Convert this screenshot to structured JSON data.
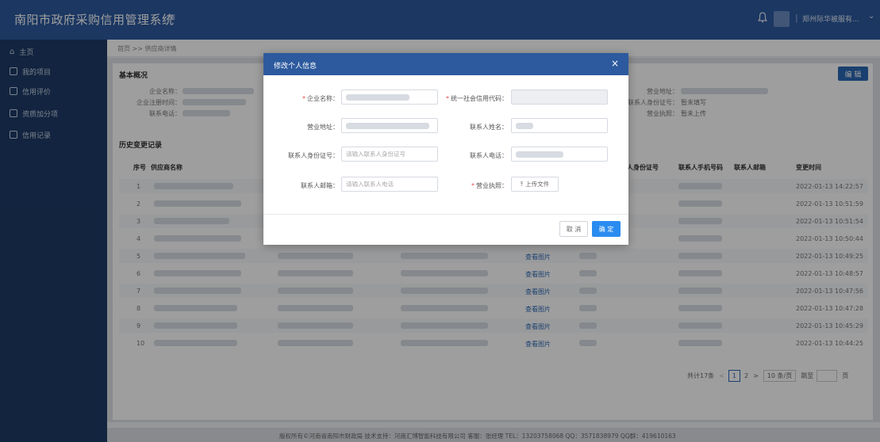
{
  "header": {
    "app_title": "南阳市政府采购信用管理系统",
    "menu_toggle": "≡",
    "user_name": "郑州际华被服有...",
    "separator": "|"
  },
  "sidebar": {
    "items": [
      {
        "label": "主页"
      },
      {
        "label": "我的项目"
      },
      {
        "label": "信用评价"
      },
      {
        "label": "资质加分项"
      },
      {
        "label": "信用记录"
      }
    ]
  },
  "breadcrumb": "首页 >> 供应商详情",
  "basic_info": {
    "title": "基本概况",
    "edit_label": "编 辑",
    "left_labels": [
      "企业名称：",
      "企业注册时间：",
      "联系电话："
    ],
    "right_labels": [
      "营业地址：",
      "联系人身份证号：",
      "营业执照："
    ],
    "right_values": [
      "",
      "暂未填写",
      "暂未上传"
    ]
  },
  "history": {
    "title": "历史变更记录",
    "columns": [
      "序号",
      "供应商名称",
      "人身份证号",
      "联系人手机号码",
      "联系人邮箱",
      "变更时间"
    ],
    "rows": [
      {
        "no": "1",
        "view": "",
        "time": "2022-01-13 14:22:57"
      },
      {
        "no": "2",
        "view": "",
        "time": "2022-01-13 10:51:59"
      },
      {
        "no": "3",
        "view": "",
        "time": "2022-01-13 10:51:54"
      },
      {
        "no": "4",
        "view": "",
        "time": "2022-01-13 10:50:44"
      },
      {
        "no": "5",
        "view": "查看图片",
        "time": "2022-01-13 10:49:25"
      },
      {
        "no": "6",
        "view": "查看图片",
        "time": "2022-01-13 10:48:57"
      },
      {
        "no": "7",
        "view": "查看图片",
        "time": "2022-01-13 10:47:56"
      },
      {
        "no": "8",
        "view": "查看图片",
        "time": "2022-01-13 10:47:28"
      },
      {
        "no": "9",
        "view": "查看图片",
        "time": "2022-01-13 10:45:29"
      },
      {
        "no": "10",
        "view": "查看图片",
        "time": "2022-01-13 10:44:25"
      }
    ]
  },
  "pager": {
    "total": "共计17条",
    "page1": "1",
    "page2": "2",
    "next": ">",
    "prev": "<",
    "page_size": "10 条/页",
    "goto": "跳至",
    "page_unit": "页"
  },
  "footer": "版权所有©河南省南阳市财政局  技术支持：河南汇博智能科技有限公司  客服：张经理  TEL：13203758068  QQ：3571838979  QQ群：419610163",
  "modal": {
    "title": "修改个人信息",
    "close": "×",
    "fields": {
      "company_name": {
        "label": "企业名称：",
        "value": ""
      },
      "credit_code": {
        "label": "统一社会信用代码：",
        "value": ""
      },
      "address": {
        "label": "营业地址：",
        "value": ""
      },
      "contact_name": {
        "label": "联系人姓名：",
        "value": ""
      },
      "contact_id": {
        "label": "联系人身份证号：",
        "placeholder": "请输入联系人身份证号"
      },
      "contact_phone": {
        "label": "联系人电话：",
        "value": ""
      },
      "contact_email": {
        "label": "联系人邮箱：",
        "placeholder": "请输入联系人电话"
      },
      "license": {
        "label": "营业执照：",
        "button": "上传文件"
      }
    },
    "cancel_label": "取 消",
    "ok_label": "确 定"
  }
}
